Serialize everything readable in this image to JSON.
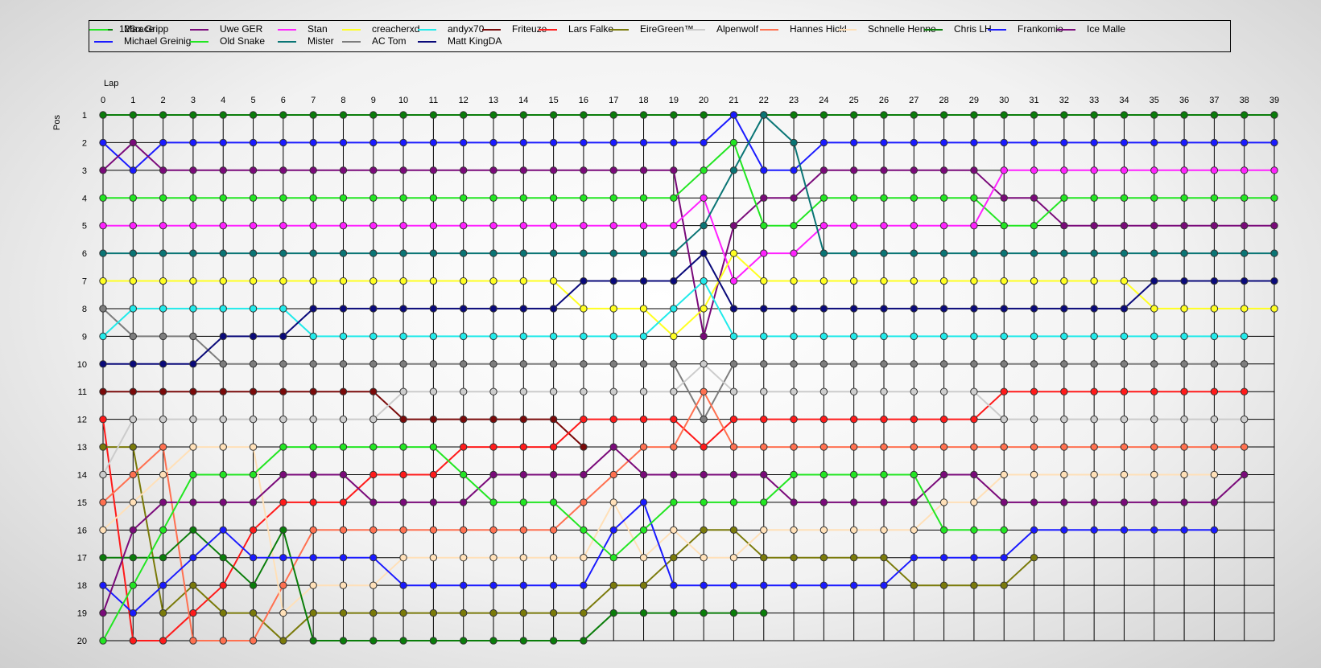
{
  "chart_data": {
    "type": "line",
    "xlabel": "Lap",
    "ylabel": "Pos",
    "x": [
      0,
      1,
      2,
      3,
      4,
      5,
      6,
      7,
      8,
      9,
      10,
      11,
      12,
      13,
      14,
      15,
      16,
      17,
      18,
      19,
      20,
      21,
      22,
      23,
      24,
      25,
      26,
      27,
      28,
      29,
      30,
      31,
      32,
      33,
      34,
      35,
      36,
      37,
      38,
      39
    ],
    "y_ticks": [
      1,
      2,
      3,
      4,
      5,
      6,
      7,
      8,
      9,
      10,
      11,
      12,
      13,
      14,
      15,
      16,
      17,
      18,
      19,
      20
    ],
    "xlim": [
      0,
      39
    ],
    "ylim": [
      1,
      20
    ],
    "y_inverted": true,
    "grid": true,
    "legend_position": "top",
    "series": [
      {
        "name": "Max Gripp",
        "color": "#0a7d0a",
        "values": [
          1,
          1,
          1,
          1,
          1,
          1,
          1,
          1,
          1,
          1,
          1,
          1,
          1,
          1,
          1,
          1,
          1,
          1,
          1,
          1,
          1,
          1,
          1,
          1,
          1,
          1,
          1,
          1,
          1,
          1,
          1,
          1,
          1,
          1,
          1,
          1,
          1,
          1,
          1,
          1
        ]
      },
      {
        "name": "Michael Greinig",
        "color": "#1a1aff",
        "values": [
          2,
          3,
          2,
          2,
          2,
          2,
          2,
          2,
          2,
          2,
          2,
          2,
          2,
          2,
          2,
          2,
          2,
          2,
          2,
          2,
          2,
          1,
          3,
          3,
          2,
          2,
          2,
          2,
          2,
          2,
          2,
          2,
          2,
          2,
          2,
          2,
          2,
          2,
          2,
          2
        ]
      },
      {
        "name": "Uwe GER",
        "color": "#7a0a7a",
        "values": [
          3,
          2,
          3,
          3,
          3,
          3,
          3,
          3,
          3,
          3,
          3,
          3,
          3,
          3,
          3,
          3,
          3,
          3,
          3,
          3,
          9,
          5,
          4,
          4,
          3,
          3,
          3,
          3,
          3,
          3,
          4,
          4,
          5,
          5,
          5,
          5,
          5,
          5,
          5,
          5
        ]
      },
      {
        "name": "Old Snake",
        "color": "#22e622",
        "values": [
          4,
          4,
          4,
          4,
          4,
          4,
          4,
          4,
          4,
          4,
          4,
          4,
          4,
          4,
          4,
          4,
          4,
          4,
          4,
          4,
          3,
          2,
          5,
          5,
          4,
          4,
          4,
          4,
          4,
          4,
          5,
          5,
          4,
          4,
          4,
          4,
          4,
          4,
          4,
          4
        ]
      },
      {
        "name": "Stan",
        "color": "#ff22ff",
        "values": [
          5,
          5,
          5,
          5,
          5,
          5,
          5,
          5,
          5,
          5,
          5,
          5,
          5,
          5,
          5,
          5,
          5,
          5,
          5,
          5,
          4,
          7,
          6,
          6,
          5,
          5,
          5,
          5,
          5,
          5,
          3,
          3,
          3,
          3,
          3,
          3,
          3,
          3,
          3,
          3
        ]
      },
      {
        "name": "Mister",
        "color": "#0a7575",
        "values": [
          6,
          6,
          6,
          6,
          6,
          6,
          6,
          6,
          6,
          6,
          6,
          6,
          6,
          6,
          6,
          6,
          6,
          6,
          6,
          6,
          5,
          3,
          1,
          2,
          6,
          6,
          6,
          6,
          6,
          6,
          6,
          6,
          6,
          6,
          6,
          6,
          6,
          6,
          6,
          6
        ]
      },
      {
        "name": "creacherxd",
        "color": "#ffff22",
        "values": [
          7,
          7,
          7,
          7,
          7,
          7,
          7,
          7,
          7,
          7,
          7,
          7,
          7,
          7,
          7,
          7,
          8,
          8,
          8,
          9,
          8,
          6,
          7,
          7,
          7,
          7,
          7,
          7,
          7,
          7,
          7,
          7,
          7,
          7,
          7,
          8,
          8,
          8,
          8,
          8
        ]
      },
      {
        "name": "AC Tom",
        "color": "#7d7d7d",
        "values": [
          8,
          9,
          9,
          9,
          10,
          10,
          10,
          10,
          10,
          10,
          10,
          10,
          10,
          10,
          10,
          10,
          10,
          10,
          10,
          10,
          12,
          10,
          10,
          10,
          10,
          10,
          10,
          10,
          10,
          10,
          10,
          10,
          10,
          10,
          10,
          10,
          10,
          10,
          10,
          null
        ]
      },
      {
        "name": "andyx70",
        "color": "#22eaea",
        "values": [
          9,
          8,
          8,
          8,
          8,
          8,
          8,
          9,
          9,
          9,
          9,
          9,
          9,
          9,
          9,
          9,
          9,
          9,
          9,
          8,
          7,
          9,
          9,
          9,
          9,
          9,
          9,
          9,
          9,
          9,
          9,
          9,
          9,
          9,
          9,
          9,
          9,
          9,
          9,
          null
        ]
      },
      {
        "name": "Matt KingDA",
        "color": "#0a0a7a",
        "values": [
          10,
          10,
          10,
          10,
          9,
          9,
          9,
          8,
          8,
          8,
          8,
          8,
          8,
          8,
          8,
          8,
          7,
          7,
          7,
          7,
          6,
          8,
          8,
          8,
          8,
          8,
          8,
          8,
          8,
          8,
          8,
          8,
          8,
          8,
          8,
          7,
          7,
          7,
          7,
          7
        ]
      },
      {
        "name": "Friteuze",
        "color": "#7a0a0a",
        "values": [
          11,
          11,
          11,
          11,
          11,
          11,
          11,
          11,
          11,
          11,
          12,
          12,
          12,
          12,
          12,
          12,
          13,
          null,
          null,
          null,
          null,
          null,
          null,
          null,
          null,
          null,
          null,
          null,
          null,
          null,
          null,
          null,
          null,
          null,
          null,
          null,
          null,
          null,
          null,
          null
        ]
      },
      {
        "name": "Lars Falke",
        "color": "#ff1a1a",
        "values": [
          12,
          20,
          20,
          19,
          18,
          16,
          15,
          15,
          15,
          14,
          14,
          14,
          13,
          13,
          13,
          13,
          12,
          12,
          12,
          12,
          13,
          12,
          12,
          12,
          12,
          12,
          12,
          12,
          12,
          12,
          11,
          11,
          11,
          11,
          11,
          11,
          11,
          11,
          11,
          null
        ]
      },
      {
        "name": "EireGreen™",
        "color": "#7a7a0a",
        "values": [
          13,
          13,
          19,
          18,
          19,
          19,
          20,
          19,
          19,
          19,
          19,
          19,
          19,
          19,
          19,
          19,
          19,
          18,
          18,
          17,
          16,
          16,
          17,
          17,
          17,
          17,
          17,
          18,
          18,
          18,
          18,
          17,
          null,
          null,
          null,
          null,
          null,
          null,
          null,
          null
        ]
      },
      {
        "name": "Alpenwolf",
        "color": "#cccccc",
        "values": [
          14,
          12,
          12,
          12,
          12,
          12,
          12,
          12,
          12,
          12,
          11,
          11,
          11,
          11,
          11,
          11,
          11,
          11,
          11,
          11,
          10,
          11,
          11,
          11,
          11,
          11,
          11,
          11,
          11,
          11,
          12,
          12,
          12,
          12,
          12,
          12,
          12,
          12,
          12,
          null
        ]
      },
      {
        "name": "Hannes Hickl",
        "color": "#ff7050",
        "values": [
          15,
          14,
          13,
          20,
          20,
          20,
          18,
          16,
          16,
          16,
          16,
          16,
          16,
          16,
          16,
          16,
          15,
          14,
          13,
          13,
          11,
          13,
          13,
          13,
          13,
          13,
          13,
          13,
          13,
          13,
          13,
          13,
          13,
          13,
          13,
          13,
          13,
          13,
          13,
          null
        ]
      },
      {
        "name": "Schnelle Henne",
        "color": "#ffe0b8",
        "values": [
          16,
          15,
          14,
          13,
          13,
          13,
          19,
          18,
          18,
          18,
          17,
          17,
          17,
          17,
          17,
          17,
          17,
          15,
          17,
          16,
          17,
          17,
          16,
          16,
          16,
          16,
          16,
          16,
          15,
          15,
          14,
          14,
          14,
          14,
          14,
          14,
          14,
          14,
          null,
          null
        ]
      },
      {
        "name": "Chris LH",
        "color": "#0a7d0a",
        "values": [
          17,
          17,
          17,
          16,
          17,
          18,
          16,
          20,
          20,
          20,
          20,
          20,
          20,
          20,
          20,
          20,
          20,
          19,
          19,
          19,
          19,
          19,
          19,
          null,
          null,
          null,
          null,
          null,
          null,
          null,
          null,
          null,
          null,
          null,
          null,
          null,
          null,
          null,
          null,
          null
        ]
      },
      {
        "name": "Frankomio",
        "color": "#1a1aff",
        "values": [
          18,
          19,
          18,
          17,
          16,
          17,
          17,
          17,
          17,
          17,
          18,
          18,
          18,
          18,
          18,
          18,
          18,
          16,
          15,
          18,
          18,
          18,
          18,
          18,
          18,
          18,
          18,
          17,
          17,
          17,
          17,
          16,
          16,
          16,
          16,
          16,
          16,
          16,
          null,
          null
        ]
      },
      {
        "name": "Ice Malle",
        "color": "#7a0a7a",
        "values": [
          19,
          16,
          15,
          15,
          15,
          15,
          14,
          14,
          14,
          15,
          15,
          15,
          15,
          14,
          14,
          14,
          14,
          13,
          14,
          14,
          14,
          14,
          14,
          15,
          15,
          15,
          15,
          15,
          14,
          14,
          15,
          15,
          15,
          15,
          15,
          15,
          15,
          15,
          14,
          null
        ]
      },
      {
        "name": "126race",
        "color": "#22e622",
        "values": [
          20,
          18,
          16,
          14,
          14,
          14,
          13,
          13,
          13,
          13,
          13,
          13,
          14,
          15,
          15,
          15,
          16,
          17,
          16,
          15,
          15,
          15,
          15,
          14,
          14,
          14,
          14,
          14,
          16,
          16,
          16,
          null,
          null,
          null,
          null,
          null,
          null,
          null,
          null,
          null
        ]
      }
    ]
  }
}
